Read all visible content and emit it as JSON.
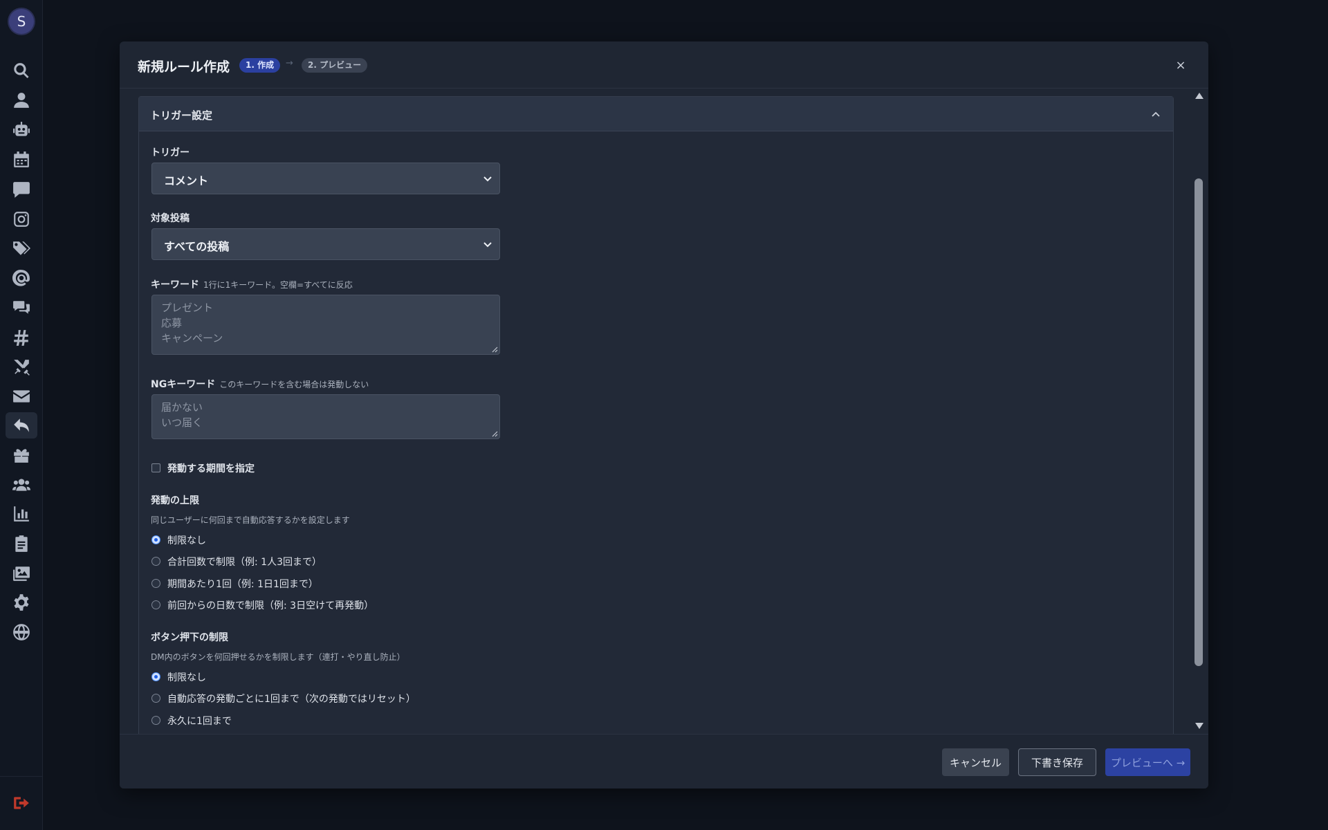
{
  "sidebar": {
    "avatar_letter": "S",
    "icons": [
      "search-icon",
      "user-icon",
      "robot-icon",
      "calendar-icon",
      "comment-icon",
      "instagram-icon",
      "tags-icon",
      "at-icon",
      "comments-icon",
      "hashtag-icon",
      "swords-icon",
      "envelope-icon",
      "reply-icon",
      "gift-icon",
      "users-icon",
      "chart-icon",
      "clipboard-icon",
      "images-icon",
      "gear-icon",
      "globe-icon"
    ],
    "active_icon": "reply-icon",
    "logout_icon": "logout-icon"
  },
  "modal": {
    "title": "新規ルール作成",
    "step1": "1. 作成",
    "step_arrow": "→",
    "step2": "2. プレビュー",
    "close": "×"
  },
  "section": {
    "title": "トリガー設定"
  },
  "form": {
    "trigger_label": "トリガー",
    "trigger_value": "コメント",
    "target_label": "対象投稿",
    "target_value": "すべての投稿",
    "keyword_label": "キーワード",
    "keyword_hint": "1行に1キーワード。空欄=すべてに反応",
    "keyword_placeholder": [
      "プレゼント",
      "応募",
      "キャンペーン"
    ],
    "ng_label": "NGキーワード",
    "ng_hint": "このキーワードを含む場合は発動しない",
    "ng_placeholder": [
      "届かない",
      "いつ届く"
    ],
    "period_checkbox": "発動する期間を指定",
    "limit_label": "発動の上限",
    "limit_desc": "同じユーザーに何回まで自動応答するかを設定します",
    "limit_options": [
      "制限なし",
      "合計回数で制限（例: 1人3回まで）",
      "期間あたり1回（例: 1日1回まで）",
      "前回からの日数で制限（例: 3日空けて再発動）"
    ],
    "button_label": "ボタン押下の制限",
    "button_desc": "DM内のボタンを何回押せるかを制限します（連打・やり直し防止）",
    "button_options": [
      "制限なし",
      "自動応答の発動ごとに1回まで（次の発動ではリセット）",
      "永久に1回まで"
    ]
  },
  "footer": {
    "cancel": "キャンセル",
    "draft": "下書き保存",
    "preview": "プレビューへ →"
  },
  "colors": {
    "accent": "#2c42a2",
    "background": "#0e131c",
    "modal": "#1f2633"
  }
}
